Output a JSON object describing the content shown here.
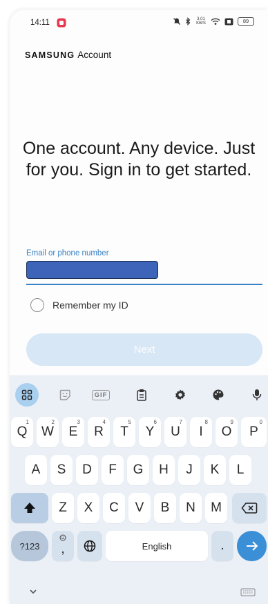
{
  "status_bar": {
    "time": "14:11",
    "network_rate": "3.01 KB/S",
    "battery": "89"
  },
  "header": {
    "brand_logo": "SAMSUNG",
    "brand_product": "Account"
  },
  "main": {
    "headline": "One account. Any device. Just for you. Sign in to get started.",
    "email_field": {
      "label": "Email or phone number",
      "value": ""
    },
    "remember_id": {
      "label": "Remember my ID",
      "checked": false
    },
    "next_button": "Next"
  },
  "keyboard": {
    "toolbar": {
      "gif_label": "GIF"
    },
    "rows": [
      [
        {
          "label": "Q",
          "sup": "1"
        },
        {
          "label": "W",
          "sup": "2"
        },
        {
          "label": "E",
          "sup": "3"
        },
        {
          "label": "R",
          "sup": "4"
        },
        {
          "label": "T",
          "sup": "5"
        },
        {
          "label": "Y",
          "sup": "6"
        },
        {
          "label": "U",
          "sup": "7"
        },
        {
          "label": "I",
          "sup": "8"
        },
        {
          "label": "O",
          "sup": "9"
        },
        {
          "label": "P",
          "sup": "0"
        }
      ],
      [
        {
          "label": "A"
        },
        {
          "label": "S"
        },
        {
          "label": "D"
        },
        {
          "label": "F"
        },
        {
          "label": "G"
        },
        {
          "label": "H"
        },
        {
          "label": "J"
        },
        {
          "label": "K"
        },
        {
          "label": "L"
        }
      ],
      [
        {
          "label": "Z"
        },
        {
          "label": "X"
        },
        {
          "label": "C"
        },
        {
          "label": "V"
        },
        {
          "label": "B"
        },
        {
          "label": "N"
        },
        {
          "label": "M"
        }
      ]
    ],
    "symbols_key": "?123",
    "comma_key": ",",
    "space_key": "English",
    "period_key": ".",
    "colors": {
      "accent": "#3b8fd6",
      "background": "#ebf0f7"
    }
  }
}
